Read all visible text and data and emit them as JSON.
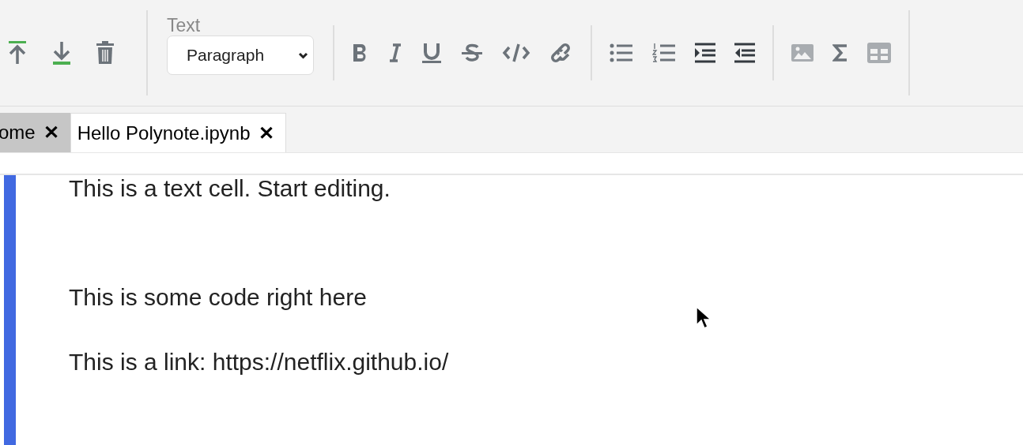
{
  "toolbar": {
    "cell_buttons": [
      {
        "kind": "move-up",
        "disabled": false
      },
      {
        "kind": "move-down",
        "disabled": false
      },
      {
        "kind": "delete",
        "disabled": false
      }
    ],
    "text_group": {
      "label": "Text",
      "style_select": {
        "value": "Paragraph"
      }
    },
    "format_buttons": [
      {
        "kind": "bold",
        "disabled": false
      },
      {
        "kind": "italic",
        "disabled": false
      },
      {
        "kind": "underline",
        "disabled": false
      },
      {
        "kind": "strikethrough",
        "disabled": false
      },
      {
        "kind": "code",
        "disabled": false
      },
      {
        "kind": "link",
        "disabled": false
      }
    ],
    "list_buttons": [
      {
        "kind": "bullet-list",
        "disabled": false
      },
      {
        "kind": "numbered-list",
        "disabled": false
      },
      {
        "kind": "indent",
        "disabled": false
      },
      {
        "kind": "outdent",
        "disabled": false
      }
    ],
    "insert_buttons": [
      {
        "kind": "image",
        "disabled": true
      },
      {
        "kind": "sigma",
        "disabled": false
      },
      {
        "kind": "table",
        "disabled": true
      }
    ]
  },
  "tabs": [
    {
      "label": "ome",
      "close": "✕",
      "selected": false
    },
    {
      "label": "Hello Polynote.ipynb",
      "close": "✕",
      "selected": true
    }
  ],
  "cell": {
    "active": true,
    "paragraphs": [
      "This is a text cell. Start editing.",
      "This is some code right here",
      "This is a link: https://netflix.github.io/"
    ]
  }
}
